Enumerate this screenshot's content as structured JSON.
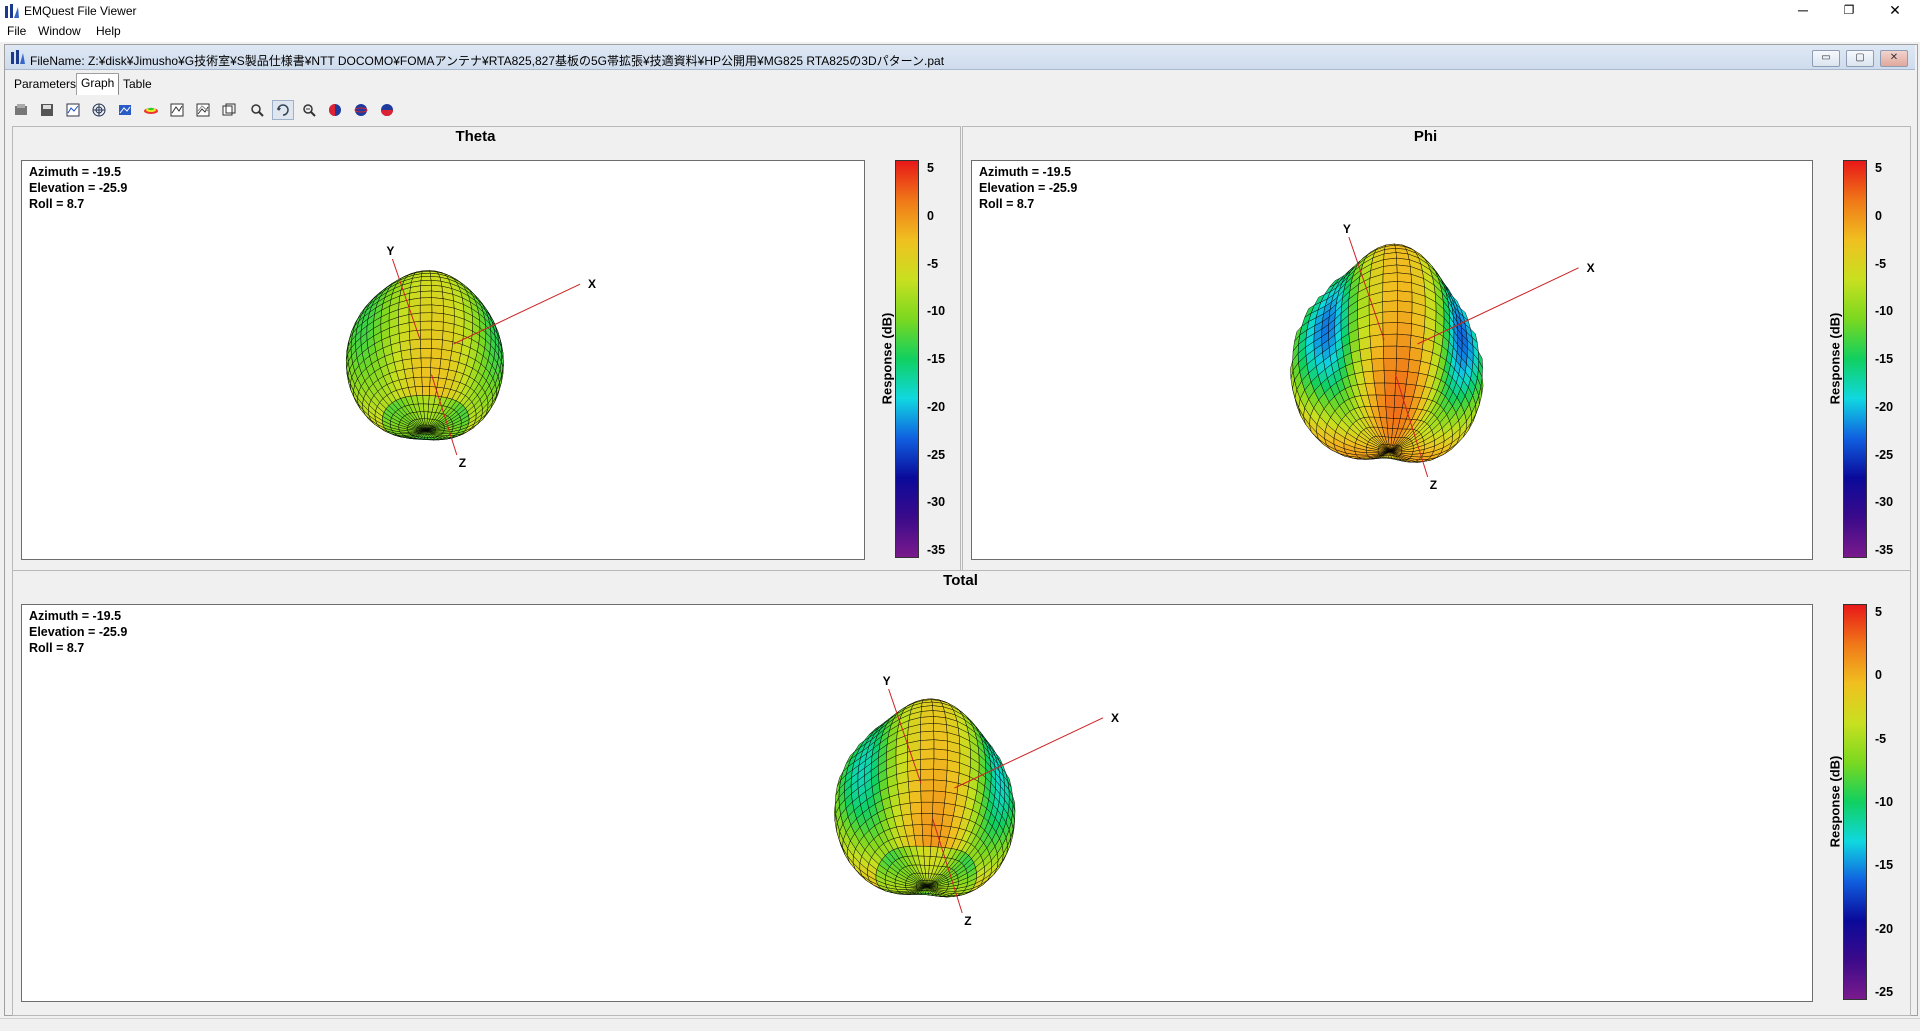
{
  "window": {
    "title": "EMQuest File Viewer",
    "minimize_glyph": "─",
    "maximize_glyph": "❐",
    "close_glyph": "✕"
  },
  "menu": {
    "items": [
      "File",
      "Window",
      "Help"
    ]
  },
  "child": {
    "file_label": "FileName:",
    "file_path": "Z:¥disk¥Jimusho¥G技術室¥S製品仕様書¥NTT DOCOMO¥FOMAアンテナ¥RTA825,827基板の5G帯拡張¥技適資料¥HP公開用¥MG825 RTA825の3Dパターン.pat",
    "btn_min": "▭",
    "btn_max": "▢",
    "btn_close": "✕"
  },
  "tabs": [
    {
      "label": "Parameters",
      "active": false
    },
    {
      "label": "Graph",
      "active": true
    },
    {
      "label": "Table",
      "active": false
    }
  ],
  "toolbar": {
    "buttons": [
      "open-icon",
      "save-icon",
      "3d-plot-icon",
      "polar-plot-icon",
      "rect-plot-icon",
      "contour-plot-icon",
      "line-plot-icon",
      "dual-line-icon",
      "overlay-icon",
      "zoom-icon",
      "rotate-icon",
      "zoom-fit-icon",
      "sphere-left-icon",
      "sphere-icon",
      "sphere-bottom-icon"
    ],
    "pressed": [
      "rotate-icon"
    ]
  },
  "panels": [
    {
      "id": "theta",
      "title": "Theta",
      "azimuth": "Azimuth = -19.5",
      "elevation": "Elevation = -25.9",
      "roll": "Roll = 8.7",
      "axis_x": "X",
      "axis_y": "Y",
      "axis_z": "Z",
      "colorbar_label": "Response  (dB)",
      "colorbar_ticks": [
        "5",
        "0",
        "-5",
        "-10",
        "-15",
        "-20",
        "-25",
        "-30",
        "-35"
      ],
      "range": [
        -35,
        5
      ],
      "shape": "theta"
    },
    {
      "id": "phi",
      "title": "Phi",
      "azimuth": "Azimuth = -19.5",
      "elevation": "Elevation = -25.9",
      "roll": "Roll = 8.7",
      "axis_x": "X",
      "axis_y": "Y",
      "axis_z": "Z",
      "colorbar_label": "Response  (dB)",
      "colorbar_ticks": [
        "5",
        "0",
        "-5",
        "-10",
        "-15",
        "-20",
        "-25",
        "-30",
        "-35"
      ],
      "range": [
        -35,
        5
      ],
      "shape": "phi"
    },
    {
      "id": "total",
      "title": "Total",
      "azimuth": "Azimuth = -19.5",
      "elevation": "Elevation = -25.9",
      "roll": "Roll = 8.7",
      "axis_x": "X",
      "axis_y": "Y",
      "axis_z": "Z",
      "colorbar_label": "Response  (dB)",
      "colorbar_ticks": [
        "5",
        "0",
        "-5",
        "-10",
        "-15",
        "-20",
        "-25"
      ],
      "range": [
        -25,
        5
      ],
      "shape": "total"
    }
  ],
  "colors": {
    "colormap": [
      "#7a1a8c",
      "#3a0a8a",
      "#0a0a9a",
      "#1060e0",
      "#10d8e0",
      "#10d060",
      "#7ad820",
      "#c8e020",
      "#f0c020",
      "#f07818",
      "#e81818"
    ],
    "mesh": "#000000",
    "axis_line": "#cc2222"
  }
}
